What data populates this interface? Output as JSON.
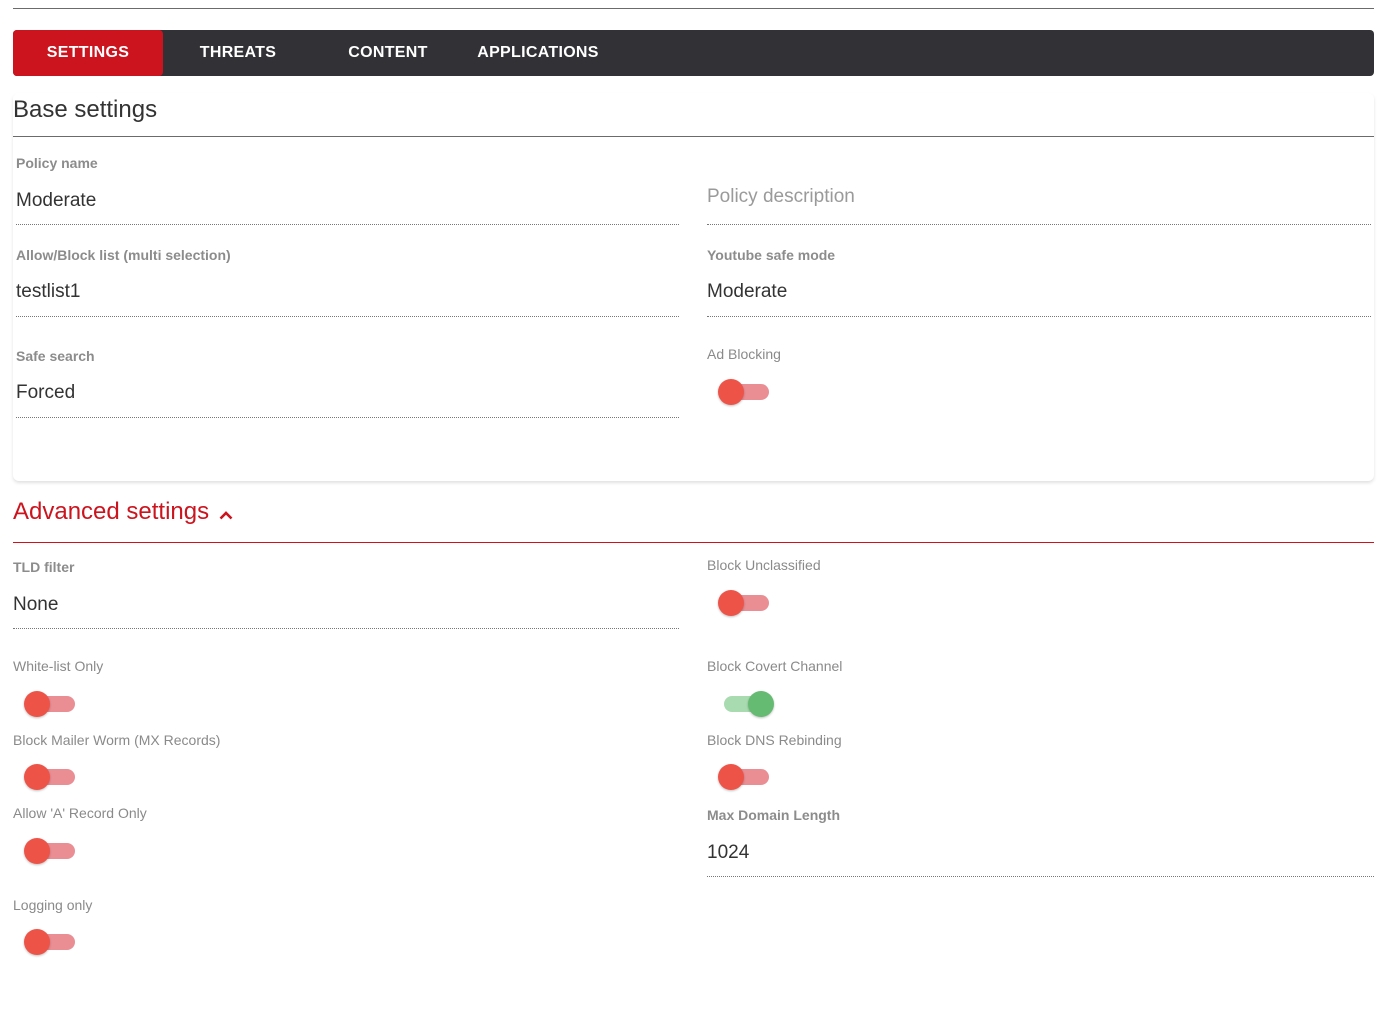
{
  "tabs": [
    {
      "label": "SETTINGS",
      "active": true
    },
    {
      "label": "THREATS",
      "active": false
    },
    {
      "label": "CONTENT",
      "active": false
    },
    {
      "label": "APPLICATIONS",
      "active": false
    }
  ],
  "base_settings": {
    "title": "Base settings",
    "policy_name": {
      "label": "Policy name",
      "value": "Moderate"
    },
    "policy_description": {
      "placeholder": "Policy description",
      "value": ""
    },
    "allow_block_list": {
      "label": "Allow/Block list (multi selection)",
      "value": "testlist1"
    },
    "youtube_safe_mode": {
      "label": "Youtube safe mode",
      "value": "Moderate"
    },
    "safe_search": {
      "label": "Safe search",
      "value": "Forced"
    },
    "ad_blocking": {
      "label": "Ad Blocking",
      "enabled": false
    }
  },
  "advanced_settings": {
    "title": "Advanced settings",
    "expanded": true,
    "tld_filter": {
      "label": "TLD filter",
      "value": "None"
    },
    "block_unclassified": {
      "label": "Block Unclassified",
      "enabled": false
    },
    "white_list_only": {
      "label": "White-list Only",
      "enabled": false
    },
    "block_covert_channel": {
      "label": "Block Covert Channel",
      "enabled": true
    },
    "block_mailer_worm": {
      "label": "Block Mailer Worm (MX Records)",
      "enabled": false
    },
    "block_dns_rebinding": {
      "label": "Block DNS Rebinding",
      "enabled": false
    },
    "allow_a_record_only": {
      "label": "Allow 'A' Record Only",
      "enabled": false
    },
    "max_domain_length": {
      "label": "Max Domain Length",
      "value": "1024"
    },
    "logging_only": {
      "label": "Logging only",
      "enabled": false
    }
  },
  "colors": {
    "accent": "#cc141e",
    "tabbar_bg": "#323236",
    "toggle_off_knob": "#ee5347",
    "toggle_off_track": "#ea8e94",
    "toggle_on_knob": "#66bb72",
    "toggle_on_track": "#a8dbb0"
  }
}
